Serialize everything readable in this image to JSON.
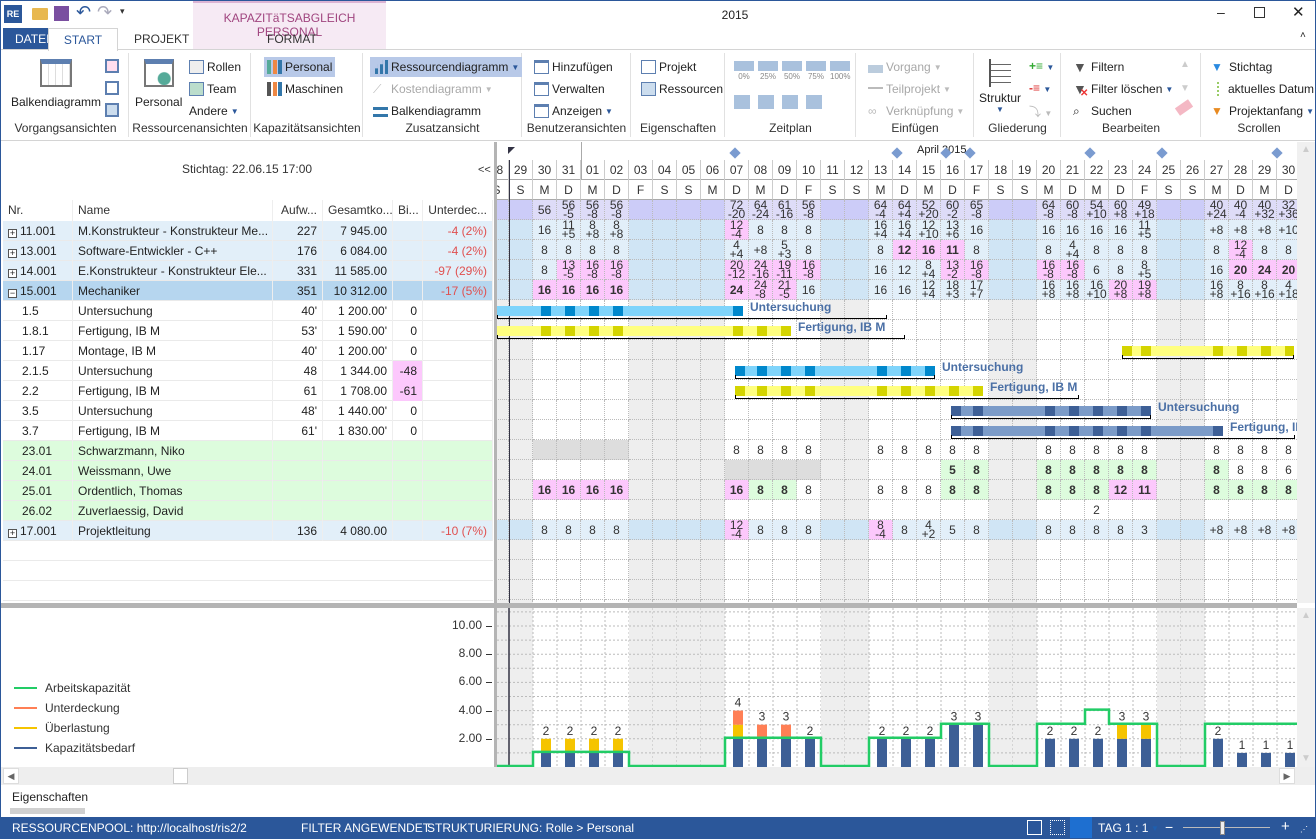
{
  "app": {
    "title": "2015",
    "context_tab_header": "KAPAZITäTSABGLEICH PERSONAL",
    "quick_access": [
      "app-icon",
      "open-icon",
      "save-icon",
      "undo-icon",
      "redo-icon",
      "customize-icon"
    ]
  },
  "tabs": [
    {
      "label": "DATEI"
    },
    {
      "label": "START",
      "selected": true
    },
    {
      "label": "PROJEKT"
    },
    {
      "label": "FORMAT"
    }
  ],
  "ribbon": {
    "vorgangsansichten": {
      "label": "Vorgangsansichten",
      "big": "Balkendiagramm"
    },
    "ressourcenansichten": {
      "label": "Ressourcenansichten",
      "big": "Personal",
      "items": [
        "Rollen",
        "Team",
        "Andere"
      ]
    },
    "kapazitaetsansichten": {
      "label": "Kapazitätsansichten",
      "items": [
        "Personal",
        "Maschinen"
      ]
    },
    "zusatzansicht": {
      "label": "Zusatzansicht",
      "items": [
        "Ressourcendiagramm",
        "Kostendiagramm",
        "Balkendiagramm"
      ]
    },
    "benutzeransichten": {
      "label": "Benutzeransichten",
      "items": [
        "Hinzufügen",
        "Verwalten",
        "Anzeigen"
      ]
    },
    "eigenschaften": {
      "label": "Eigenschaften",
      "items": [
        "Projekt",
        "Ressourcen"
      ]
    },
    "zeitplan": {
      "label": "Zeitplan",
      "percent": [
        "0%",
        "25%",
        "50%",
        "75%",
        "100%"
      ]
    },
    "einfuegen": {
      "label": "Einfügen",
      "items": [
        "Vorgang",
        "Teilprojekt",
        "Verknüpfung"
      ]
    },
    "gliederung": {
      "label": "Gliederung",
      "big": "Struktur"
    },
    "bearbeiten": {
      "label": "Bearbeiten",
      "items": [
        "Filtern",
        "Filter löschen",
        "Suchen"
      ]
    },
    "scrollen": {
      "label": "Scrollen",
      "items": [
        "Stichtag",
        "aktuelles Datum",
        "Projektanfang"
      ]
    }
  },
  "left": {
    "stichtag": "Stichtag: 22.06.15 17:00",
    "collapse": "<<",
    "columns": [
      "Nr.",
      "Name",
      "Aufw...",
      "Gesamtko...",
      "Bi...",
      "Unterdec..."
    ],
    "rows": [
      {
        "type": "group",
        "nr": "11.001",
        "name": "M.Konstrukteur - Konstrukteur Me...",
        "aufw": "227",
        "kosten": "7 945.00",
        "bi": "",
        "unter": "-4 (2%)"
      },
      {
        "type": "group",
        "nr": "13.001",
        "name": "Software-Entwickler - C++",
        "aufw": "176",
        "kosten": "6 084.00",
        "bi": "",
        "unter": "-4 (2%)"
      },
      {
        "type": "group",
        "nr": "14.001",
        "name": "E.Konstrukteur - Konstrukteur Ele...",
        "aufw": "331",
        "kosten": "11 585.00",
        "bi": "",
        "unter": "-97 (29%)"
      },
      {
        "type": "selected",
        "nr": "15.001",
        "name": "Mechaniker",
        "aufw": "351",
        "kosten": "10 312.00",
        "bi": "",
        "unter": "-17 (5%)"
      },
      {
        "type": "task",
        "nr": "1.5",
        "name": "Untersuchung",
        "aufw": "40'",
        "kosten": "1 200.00'",
        "bi": "0",
        "unter": ""
      },
      {
        "type": "task",
        "nr": "1.8.1",
        "name": "Fertigung, IB M",
        "aufw": "53'",
        "kosten": "1 590.00'",
        "bi": "0",
        "unter": ""
      },
      {
        "type": "task",
        "nr": "1.17",
        "name": "Montage, IB M",
        "aufw": "40'",
        "kosten": "1 200.00'",
        "bi": "0",
        "unter": ""
      },
      {
        "type": "task",
        "nr": "2.1.5",
        "name": "Untersuchung",
        "aufw": "48",
        "kosten": "1 344.00",
        "bi": "-48",
        "bi_over": true,
        "unter": ""
      },
      {
        "type": "task",
        "nr": "2.2",
        "name": "Fertigung, IB M",
        "aufw": "61",
        "kosten": "1 708.00",
        "bi": "-61",
        "bi_over": true,
        "unter": ""
      },
      {
        "type": "task",
        "nr": "3.5",
        "name": "Untersuchung",
        "aufw": "48'",
        "kosten": "1 440.00'",
        "bi": "0",
        "unter": ""
      },
      {
        "type": "task",
        "nr": "3.7",
        "name": "Fertigung, IB M",
        "aufw": "61'",
        "kosten": "1 830.00'",
        "bi": "0",
        "unter": ""
      },
      {
        "type": "resource",
        "nr": "23.01",
        "name": "Schwarzmann, Niko"
      },
      {
        "type": "resource",
        "nr": "24.01",
        "name": "Weissmann, Uwe"
      },
      {
        "type": "resource",
        "nr": "25.01",
        "name": "Ordentlich, Thomas"
      },
      {
        "type": "resource",
        "nr": "26.02",
        "name": "Zuverlaessig, David"
      },
      {
        "type": "group",
        "nr": "17.001",
        "name": "Projektleitung",
        "aufw": "136",
        "kosten": "4 080.00",
        "bi": "",
        "unter": "-10 (7%)"
      }
    ]
  },
  "timeline": {
    "month": "April 2015",
    "dates": [
      "28",
      "29",
      "30",
      "31",
      "01",
      "02",
      "03",
      "04",
      "05",
      "06",
      "07",
      "08",
      "09",
      "10",
      "11",
      "12",
      "13",
      "14",
      "15",
      "16",
      "17",
      "18",
      "19",
      "20",
      "21",
      "22",
      "23",
      "24",
      "25",
      "26",
      "27",
      "28",
      "29",
      "30"
    ],
    "weekdays": [
      "S",
      "S",
      "M",
      "D",
      "M",
      "D",
      "F",
      "S",
      "S",
      "M",
      "D",
      "M",
      "D",
      "F",
      "S",
      "S",
      "M",
      "D",
      "M",
      "D",
      "F",
      "S",
      "S",
      "M",
      "D",
      "M",
      "D",
      "F",
      "S",
      "S",
      "M",
      "D",
      "M",
      "D"
    ],
    "non_working": [
      "28",
      "29",
      "03",
      "04",
      "05",
      "06",
      "11",
      "12",
      "18",
      "19",
      "25",
      "26"
    ]
  },
  "grid": {
    "total": [
      "",
      "",
      "56",
      "56/-5",
      "56/-8",
      "56/-8",
      "",
      "",
      "",
      "",
      "72/-20",
      "64/-24",
      "61/-16",
      "56/-8",
      "",
      "",
      "64/-4",
      "64/+4",
      "52/+20",
      "60/-2",
      "65/-8",
      "",
      "",
      "64/-8",
      "60/-8",
      "54/+10",
      "60/+8",
      "49/+18",
      "",
      "",
      "40/+24",
      "40/-4",
      "40/+32",
      "32/+36"
    ],
    "rows": [
      [
        "",
        "",
        "16",
        "11/+5",
        "8/+8",
        "8/+8",
        "",
        "",
        "",
        "",
        {
          "v": "12/-4",
          "s": "over"
        },
        "8",
        "8",
        "8",
        "",
        "",
        "16/+4",
        "16/+4",
        "12/+10",
        "13/+6",
        "16",
        "",
        "",
        "16",
        "16",
        "16",
        "16",
        "11/+5",
        "",
        "",
        "+8",
        "+8",
        "+8",
        "+10"
      ],
      [
        "",
        "",
        "8",
        "8",
        "8",
        "8",
        "",
        "",
        "",
        "",
        "4/+4",
        "+8",
        "5/+3",
        "8",
        "",
        "",
        "8",
        {
          "v": "12",
          "s": "over"
        },
        {
          "v": "16",
          "s": "over"
        },
        {
          "v": "11",
          "s": "over"
        },
        "8",
        "",
        "",
        "8",
        "4/+4",
        "8",
        "8",
        "8",
        "",
        "",
        "8",
        {
          "v": "12/-4",
          "s": "over"
        },
        "8",
        "8"
      ],
      [
        "",
        "",
        "8",
        {
          "v": "13/-5",
          "s": "over"
        },
        {
          "v": "16/-8",
          "s": "over"
        },
        {
          "v": "16/-8",
          "s": "over"
        },
        "",
        "",
        "",
        "",
        {
          "v": "20/-12",
          "s": "over"
        },
        {
          "v": "24/-16",
          "s": "over"
        },
        {
          "v": "19/-11",
          "s": "over"
        },
        {
          "v": "16/-8",
          "s": "over"
        },
        "",
        "",
        "16",
        "12",
        "8/+4",
        {
          "v": "13/-2",
          "s": "over"
        },
        {
          "v": "16/-8",
          "s": "over"
        },
        "",
        "",
        {
          "v": "16/-8",
          "s": "over"
        },
        {
          "v": "16/-8",
          "s": "over"
        },
        "6",
        "8",
        "8/+5",
        "",
        "",
        "16",
        {
          "v": "20",
          "s": "over"
        },
        {
          "v": "24",
          "s": "over"
        },
        {
          "v": "20",
          "s": "over"
        }
      ],
      [
        "",
        "",
        {
          "v": "16",
          "s": "over"
        },
        {
          "v": "16",
          "s": "over"
        },
        {
          "v": "16",
          "s": "over"
        },
        {
          "v": "16",
          "s": "over"
        },
        "",
        "",
        "",
        "",
        {
          "v": "24",
          "s": "over"
        },
        {
          "v": "24/-8",
          "s": "over"
        },
        {
          "v": "21/-5",
          "s": "over"
        },
        "16",
        "",
        "",
        "16",
        "16",
        "12/+4",
        "18/+3",
        "17/+7",
        "",
        "",
        "16/+8",
        "16/+8",
        "16/+10",
        {
          "v": "20/+8",
          "s": "over"
        },
        {
          "v": "19/+8",
          "s": "over"
        },
        "",
        "",
        "16/+8",
        "8/+16",
        "8/+16",
        "4/+18"
      ],
      [],
      [],
      [],
      [],
      [],
      [],
      [],
      [
        "",
        "",
        {
          "v": "",
          "s": "na"
        },
        {
          "v": "",
          "s": "na"
        },
        {
          "v": "",
          "s": "na"
        },
        {
          "v": "",
          "s": "na"
        },
        "",
        "",
        "",
        "",
        "8",
        "8",
        "8",
        "8",
        "",
        "",
        "8",
        "8",
        "8",
        "8",
        "8",
        "",
        "",
        "8",
        "8",
        "8",
        "8",
        "8",
        "",
        "",
        "8",
        "8",
        "8",
        "8"
      ],
      [
        "",
        "",
        "",
        "",
        "",
        "",
        "",
        "",
        "",
        "",
        {
          "v": "",
          "s": "na"
        },
        {
          "v": "",
          "s": "na"
        },
        {
          "v": "",
          "s": "na"
        },
        {
          "v": "",
          "s": "na"
        },
        "",
        "",
        "",
        "",
        "",
        {
          "v": "5",
          "s": "free"
        },
        {
          "v": "8",
          "s": "free"
        },
        "",
        "",
        {
          "v": "8",
          "s": "free"
        },
        {
          "v": "8",
          "s": "free"
        },
        {
          "v": "8",
          "s": "free"
        },
        {
          "v": "8",
          "s": "free"
        },
        {
          "v": "8",
          "s": "free"
        },
        "",
        "",
        {
          "v": "8",
          "s": "free"
        },
        "8",
        "8",
        "6"
      ],
      [
        "",
        "",
        {
          "v": "16",
          "s": "over"
        },
        {
          "v": "16",
          "s": "over"
        },
        {
          "v": "16",
          "s": "over"
        },
        {
          "v": "16",
          "s": "over"
        },
        "",
        "",
        "",
        "",
        {
          "v": "16",
          "s": "over"
        },
        {
          "v": "8",
          "s": "free"
        },
        {
          "v": "8",
          "s": "free"
        },
        "8",
        "",
        "",
        "8",
        "8",
        "8",
        {
          "v": "8",
          "s": "free"
        },
        {
          "v": "8",
          "s": "free"
        },
        "",
        "",
        {
          "v": "8",
          "s": "free"
        },
        {
          "v": "8",
          "s": "free"
        },
        {
          "v": "8",
          "s": "free"
        },
        {
          "v": "12",
          "s": "over"
        },
        {
          "v": "11",
          "s": "over"
        },
        "",
        "",
        {
          "v": "8",
          "s": "free"
        },
        {
          "v": "8",
          "s": "free"
        },
        {
          "v": "8",
          "s": "free"
        },
        {
          "v": "8",
          "s": "free"
        }
      ],
      [
        "",
        "",
        "",
        "",
        "",
        "",
        "",
        "",
        "",
        "",
        "",
        "",
        "",
        "",
        "",
        "",
        "",
        "",
        "",
        "",
        "",
        "",
        "",
        "",
        "",
        "2",
        "",
        "",
        "",
        "",
        "",
        "",
        "",
        ""
      ],
      [
        "",
        "",
        "8",
        "8",
        "8",
        "8",
        "",
        "",
        "",
        "",
        {
          "v": "12/-4",
          "s": "over"
        },
        "8",
        "8",
        "8",
        "",
        "",
        {
          "v": "8/-4",
          "s": "over"
        },
        "8",
        "4/+2",
        "5",
        "8",
        "",
        "",
        "8",
        "8",
        "8",
        "8",
        "3",
        "",
        "",
        "+8",
        "+8",
        "+8",
        "+8"
      ]
    ]
  },
  "gantt": [
    {
      "row": 4,
      "label": "Untersuchung",
      "kind": "task-a",
      "start": "28",
      "end": "07",
      "marks": [
        "30",
        "31",
        "01",
        "02",
        "07"
      ]
    },
    {
      "row": 5,
      "label": "Fertigung, IB M",
      "kind": "task-b",
      "start": "28",
      "end": "09",
      "marks": [
        "30",
        "31",
        "01",
        "02",
        "07",
        "08",
        "09"
      ]
    },
    {
      "row": 6,
      "label": "",
      "kind": "task-b",
      "start": "23",
      "end": "30",
      "marks": [
        "23",
        "24",
        "27",
        "28",
        "29",
        "30"
      ]
    },
    {
      "row": 7,
      "label": "Untersuchung",
      "kind": "task-a",
      "start": "07",
      "end": "15",
      "marks": [
        "07",
        "08",
        "09",
        "10",
        "13",
        "14",
        "15"
      ]
    },
    {
      "row": 8,
      "label": "Fertigung, IB M",
      "kind": "task-b",
      "start": "07",
      "end": "17",
      "marks": [
        "07",
        "08",
        "09",
        "10",
        "13",
        "14",
        "15",
        "16",
        "17"
      ]
    },
    {
      "row": 9,
      "label": "Untersuchung",
      "kind": "task-c",
      "start": "16",
      "end": "24",
      "marks": [
        "16",
        "17",
        "20",
        "21",
        "22",
        "23",
        "24"
      ]
    },
    {
      "row": 10,
      "label": "Fertigung, IB M",
      "kind": "task-c",
      "start": "16",
      "end": "27",
      "marks": [
        "16",
        "17",
        "20",
        "21",
        "22",
        "23",
        "24",
        "27"
      ]
    }
  ],
  "chart_data": {
    "type": "bar",
    "categories": [
      "28",
      "29",
      "30",
      "31",
      "01",
      "02",
      "03",
      "04",
      "05",
      "06",
      "07",
      "08",
      "09",
      "10",
      "11",
      "12",
      "13",
      "14",
      "15",
      "16",
      "17",
      "18",
      "19",
      "20",
      "21",
      "22",
      "23",
      "24",
      "25",
      "26",
      "27",
      "28",
      "29",
      "30"
    ],
    "ylim": [
      0,
      11
    ],
    "yticks": [
      "2.00",
      "4.00",
      "6.00",
      "8.00",
      "10.00"
    ],
    "grid": true,
    "legend": "left",
    "series": [
      {
        "name": "Kapazitätsbedarf",
        "type": "bar",
        "color": "#3d5f96",
        "values": [
          0,
          0,
          1,
          1,
          1,
          1,
          0,
          0,
          0,
          0,
          2,
          2,
          2,
          2,
          0,
          0,
          2,
          2,
          2,
          3,
          3,
          0,
          0,
          2,
          2,
          2,
          2,
          2,
          0,
          0,
          2,
          1,
          1,
          1
        ]
      },
      {
        "name": "Überlastung",
        "type": "bar",
        "color": "#f5c400",
        "values": [
          0,
          0,
          1,
          1,
          1,
          1,
          0,
          0,
          0,
          0,
          1,
          0,
          0,
          0,
          0,
          0,
          0,
          0,
          0,
          0,
          0,
          0,
          0,
          0,
          0,
          0,
          1,
          1,
          0,
          0,
          0,
          0,
          0,
          0
        ]
      },
      {
        "name": "Unterdeckung",
        "type": "bar",
        "color": "#ff7f55",
        "values": [
          0,
          0,
          0,
          0,
          0,
          0,
          0,
          0,
          0,
          0,
          1,
          1,
          1,
          0,
          0,
          0,
          0,
          0,
          0,
          0,
          0,
          0,
          0,
          0,
          0,
          0,
          0,
          0,
          0,
          0,
          0,
          0,
          0,
          0
        ]
      },
      {
        "name": "Arbeitskapazität",
        "type": "line",
        "color": "#22cc66",
        "values": [
          0,
          0,
          1,
          1,
          1,
          1,
          0,
          0,
          0,
          0,
          2,
          2,
          2,
          2,
          0,
          0,
          2,
          2,
          2,
          3,
          3,
          0,
          0,
          3,
          3,
          4,
          3,
          3,
          0,
          0,
          3,
          3,
          3,
          3
        ]
      }
    ],
    "labels": [
      "",
      "",
      "2",
      "2",
      "2",
      "2",
      "",
      "",
      "",
      "",
      "4",
      "3",
      "3",
      "2",
      "",
      "",
      "2",
      "2",
      "2",
      "3",
      "3",
      "",
      "",
      "2",
      "2",
      "2",
      "3",
      "3",
      "",
      "",
      "2",
      "1",
      "1",
      "1"
    ]
  },
  "bottom": {
    "panel_tab": "Eigenschaften"
  },
  "status": {
    "pool": "RESSOURCENPOOL: http://localhost/ris2/2",
    "filter": "FILTER ANGEWENDET",
    "struktur": "STRUKTURIERUNG: Rolle > Personal",
    "zoom": "TAG 1 : 1",
    "minus": "−",
    "plus": "+",
    "zoom_level": 0.45
  },
  "colors": {
    "accent": "#2b579a",
    "over": "#fcc8fc",
    "free": "#ddfcdd",
    "na": "#dddddd",
    "group": "#e2eff9",
    "selected": "#b6d6ef",
    "total": "#ccccf8"
  }
}
